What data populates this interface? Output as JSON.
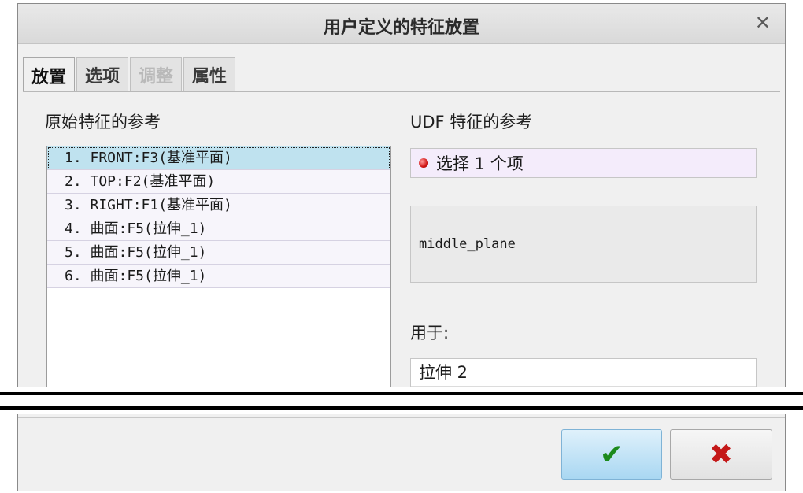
{
  "dialog": {
    "title": "用户定义的特征放置",
    "close_icon": "close-icon"
  },
  "tabs": [
    {
      "label": "放置",
      "state": "active"
    },
    {
      "label": "选项",
      "state": "normal"
    },
    {
      "label": "调整",
      "state": "disabled"
    },
    {
      "label": "属性",
      "state": "normal"
    }
  ],
  "placement": {
    "original_refs_label": "原始特征的参考",
    "udf_refs_label": "UDF 特征的参考",
    "original_refs": [
      "1.  FRONT:F3(基准平面)",
      "2.  TOP:F2(基准平面)",
      "3.  RIGHT:F1(基准平面)",
      "4.  曲面:F5(拉伸_1)",
      "5.  曲面:F5(拉伸_1)",
      "6.  曲面:F5(拉伸_1)"
    ],
    "selected_index": 0,
    "udf_select_prompt": "选择 1 个项",
    "udf_note": "middle_plane",
    "used_for_label": "用于:",
    "used_for_items": [
      "拉伸 2"
    ]
  },
  "buttons": {
    "ok_symbol": "✔",
    "cancel_symbol": "✖"
  },
  "colors": {
    "selection_highlight": "#bfe2ef",
    "required_dot": "#d11414",
    "ok_check": "#1c8a1c",
    "cancel_x": "#c41818"
  }
}
